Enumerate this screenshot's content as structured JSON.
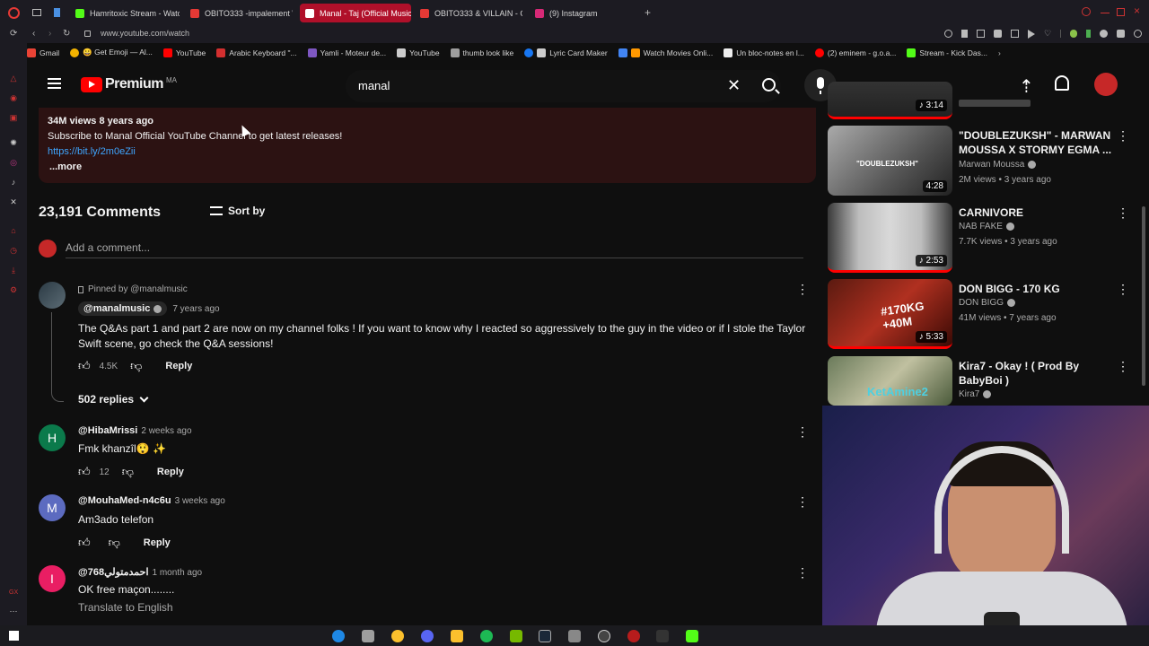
{
  "browser": {
    "tabs": [
      {
        "label": "Hamritoxic Stream - Watch",
        "color": "#53fc18",
        "active": false
      },
      {
        "label": "OBITO333 -impalement \\",
        "color": "#e53935",
        "active": false
      },
      {
        "label": "Manal - Taj (Official Music",
        "color": "#ff0000",
        "active": true
      },
      {
        "label": "OBITO333 & VILLAIN - CA",
        "color": "#e53935",
        "active": false
      },
      {
        "label": "(9) Instagram",
        "color": "#d62976",
        "active": false
      }
    ],
    "url": "www.youtube.com/watch",
    "bookmarks": [
      {
        "label": "Gmail",
        "color": "#ea4335"
      },
      {
        "label": "😀 Get Emoji — Al...",
        "color": "#f4b400"
      },
      {
        "label": "YouTube",
        "color": "#ff0000"
      },
      {
        "label": "Arabic Keyboard \"...",
        "color": "#d32f2f"
      },
      {
        "label": "Yamli - Moteur de...",
        "color": "#7e57c2"
      },
      {
        "label": "YouTube",
        "color": "#cccccc"
      },
      {
        "label": "thumb look like",
        "color": "#9e9e9e"
      },
      {
        "label": "Lyric Card Maker",
        "color": "#cccccc"
      },
      {
        "label": "Watch Movies Onli...",
        "color": "#ff9800"
      },
      {
        "label": "Un bloc-notes en l...",
        "color": "#eeeeee"
      },
      {
        "label": "(2) eminem - g.o.a...",
        "color": "#ff0000"
      },
      {
        "label": "Stream - Kick Das...",
        "color": "#53fc18"
      }
    ]
  },
  "masthead": {
    "logo_text": "Premium",
    "region": "MA",
    "search_value": "manal"
  },
  "description": {
    "stats": "34M views  8 years ago",
    "line": "Subscribe to Manal Official YouTube Channel to get latest releases!",
    "link": "https://bit.ly/2m0eZii",
    "more": "...more"
  },
  "comments_header": {
    "count": "23,191 Comments",
    "sort": "Sort by",
    "add_placeholder": "Add a comment..."
  },
  "comments": [
    {
      "pinned": "Pinned by @manalmusic",
      "author": "@manalmusic",
      "time": "7 years ago",
      "text": "The Q&As part 1 and part 2 are now on my channel folks ! If you want to know why I reacted so aggressively to the guy in the video or if I stole the Taylor Swift scene, go check the Q&A sessions!",
      "likes": "4.5K",
      "reply": "Reply",
      "replies": "502 replies"
    },
    {
      "initial": "H",
      "color": "#0b7a4b",
      "author": "@HibaMrissi",
      "time": "2 weeks ago",
      "text": "Fmk khanzîl😲 ✨",
      "likes": "12",
      "reply": "Reply"
    },
    {
      "initial": "M",
      "color": "#5c6bc0",
      "author": "@MouhaMed-n4c6u",
      "time": "3 weeks ago",
      "text": "Am3ado telefon",
      "likes": "",
      "reply": "Reply"
    },
    {
      "initial": "I",
      "color": "#e91e63",
      "author": "@768احمدمتولي",
      "time": "1 month ago",
      "text": "OK free maçon........",
      "translate": "Translate to English"
    }
  ],
  "recommendations": [
    {
      "title": "",
      "channel": "",
      "meta": "",
      "duration": "3:14"
    },
    {
      "title": "\"DOUBLEZUKSH\" - MARWAN MOUSSA X STORMY EGMA ...",
      "channel": "Marwan Moussa",
      "meta": "2M views • 3 years ago",
      "duration": "4:28",
      "thumb_text": "\"DOUBLEZUKSH\""
    },
    {
      "title": "CARNIVORE",
      "channel": "NAB FAKE",
      "meta": "7.7K views • 3 years ago",
      "duration": "2:53"
    },
    {
      "title": "DON BIGG - 170 KG",
      "channel": "DON BIGG",
      "meta": "41M views • 7 years ago",
      "duration": "5:33",
      "thumb_text": "#170KG +40M"
    },
    {
      "title": "Kira7 - Okay ! ( Prod By BabyBoi )",
      "channel": "Kira7",
      "meta": "",
      "duration": "",
      "thumb_text": "KetAmine2"
    }
  ],
  "colors": {
    "youtube_red": "#ff0000",
    "description_bg": "#2c1212",
    "link": "#3ea6ff"
  }
}
